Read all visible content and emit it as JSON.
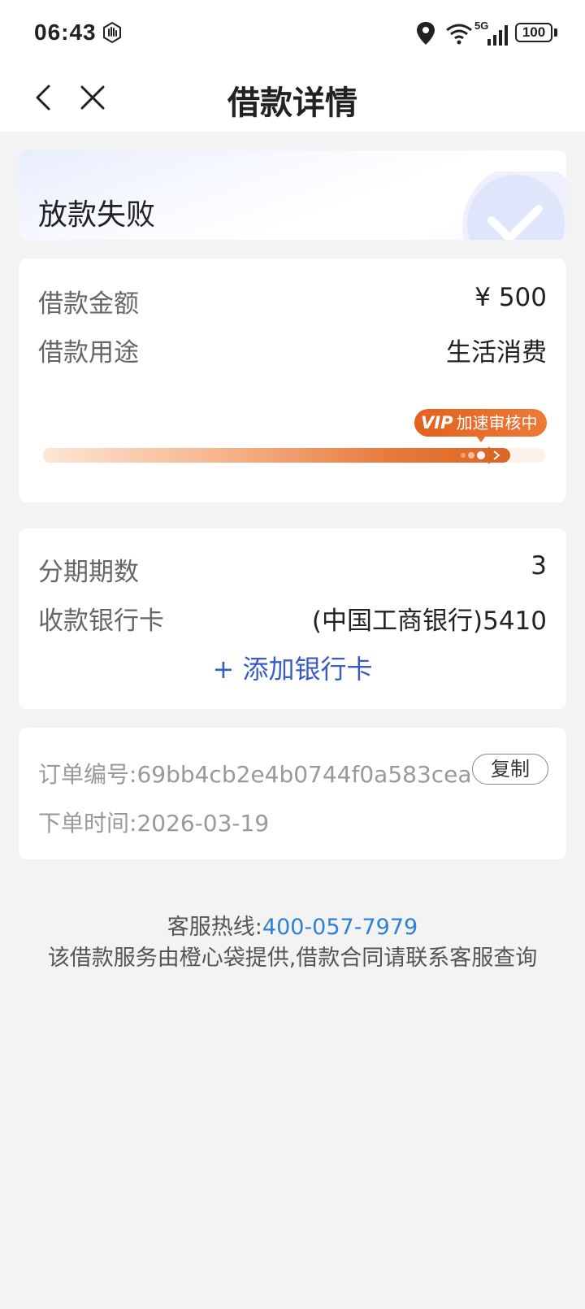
{
  "status_bar": {
    "time": "06:43",
    "battery": "100",
    "network": "5G",
    "icons": [
      "hand-icon",
      "location-icon",
      "wifi-icon",
      "signal-icon",
      "battery-icon"
    ]
  },
  "nav": {
    "title": "借款详情",
    "back_icon": "chevron-left-icon",
    "close_icon": "close-icon"
  },
  "status_card": {
    "text": "放款失败",
    "icon": "check-icon"
  },
  "loan": {
    "amount_label": "借款金额",
    "amount_value": "¥ 500",
    "purpose_label": "借款用途",
    "purpose_value": "生活消费",
    "badge_vip": "VIP",
    "badge_text": "加速审核中",
    "progress": 0.93
  },
  "bank": {
    "installments_label": "分期期数",
    "installments_value": "3",
    "card_label": "收款银行卡",
    "card_value": "(中国工商银行)5410",
    "add_card": "+ 添加银行卡"
  },
  "order": {
    "number_label": "订单编号:",
    "number_value": "69bb4cb2e4b0744f0a583cea",
    "copy_label": "复制",
    "time_label": "下单时间:",
    "time_value": "2026-03-19"
  },
  "footer": {
    "hotline_label": "客服热线:",
    "hotline_number": "400-057-7979",
    "note": "该借款服务由橙心袋提供,借款合同请联系客服查询"
  },
  "colors": {
    "accent_orange": "#e2611e",
    "link_blue": "#3a5bc7",
    "hotline_blue": "#2f7fd8",
    "background": "#f3f3f3"
  }
}
